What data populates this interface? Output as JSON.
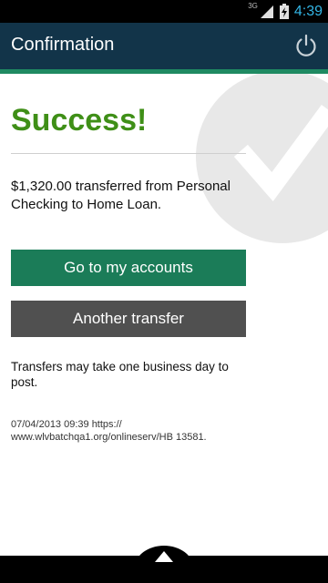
{
  "status_bar": {
    "network_type": "3G",
    "time": "4:39",
    "icons": [
      "signal-icon",
      "battery-charging-icon"
    ]
  },
  "action_bar": {
    "title": "Confirmation",
    "icon": "power-icon"
  },
  "main": {
    "headline": "Success!",
    "message": "$1,320.00 transferred from Personal Checking to Home Loan.",
    "primary_button": "Go to my accounts",
    "secondary_button": "Another transfer",
    "note": "Transfers may take one business day to post.",
    "timestamp": "07/04/2013 09:39 https://",
    "url_line": "www.wlvbatchqa1.org/onlineserv/HB 13581.",
    "background_icon": "checkmark-icon"
  },
  "bottom_bar": {
    "icon": "up-arrow-icon"
  },
  "colors": {
    "action_bar_bg": "#123449",
    "accent": "#1f8a62",
    "success_text": "#3f8f17",
    "primary_button": "#1b7c58",
    "secondary_button": "#505050",
    "status_clock": "#33b5e5"
  }
}
